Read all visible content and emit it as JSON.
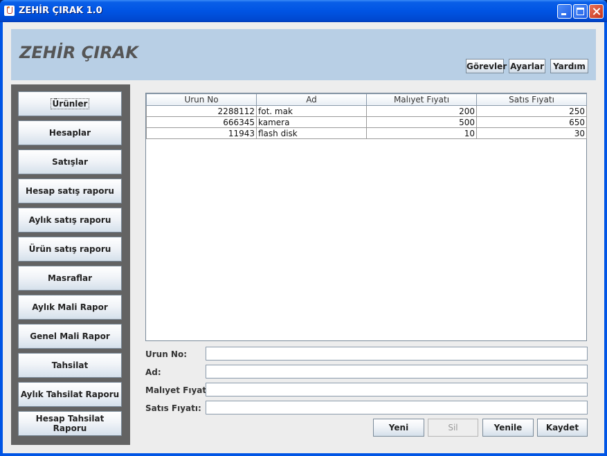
{
  "window": {
    "title": "ZEHİR ÇIRAK 1.0"
  },
  "header": {
    "app_name": "ZEHİR ÇIRAK",
    "buttons": [
      {
        "label": "Görevler"
      },
      {
        "label": "Ayarlar"
      },
      {
        "label": "Yardım"
      }
    ]
  },
  "sidebar": {
    "items": [
      {
        "label": "Ürünler",
        "active": true
      },
      {
        "label": "Hesaplar"
      },
      {
        "label": "Satışlar"
      },
      {
        "label": "Hesap satış raporu"
      },
      {
        "label": "Aylık satış raporu"
      },
      {
        "label": "Ürün satış raporu"
      },
      {
        "label": "Masraflar"
      },
      {
        "label": "Aylık Mali Rapor"
      },
      {
        "label": "Genel Mali Rapor"
      },
      {
        "label": "Tahsilat"
      },
      {
        "label": "Aylık Tahsilat Raporu"
      },
      {
        "label": "Hesap Tahsilat Raporu"
      }
    ]
  },
  "table": {
    "columns": [
      "Urun No",
      "Ad",
      "Malıyet Fıyatı",
      "Satıs Fıyatı"
    ],
    "rows": [
      [
        "2288112",
        "fot. mak",
        "200",
        "250"
      ],
      [
        "666345",
        "kamera",
        "500",
        "650"
      ],
      [
        "11943",
        "flash disk",
        "10",
        "30"
      ]
    ]
  },
  "form": {
    "fields": [
      {
        "label": "Urun No:",
        "value": ""
      },
      {
        "label": "Ad:",
        "value": ""
      },
      {
        "label": "Malıyet Fıyatı:",
        "value": ""
      },
      {
        "label": "Satıs Fıyatı:",
        "value": ""
      }
    ]
  },
  "actions": {
    "new_label": "Yeni",
    "delete_label": "Sil",
    "refresh_label": "Yenile",
    "save_label": "Kaydet"
  }
}
